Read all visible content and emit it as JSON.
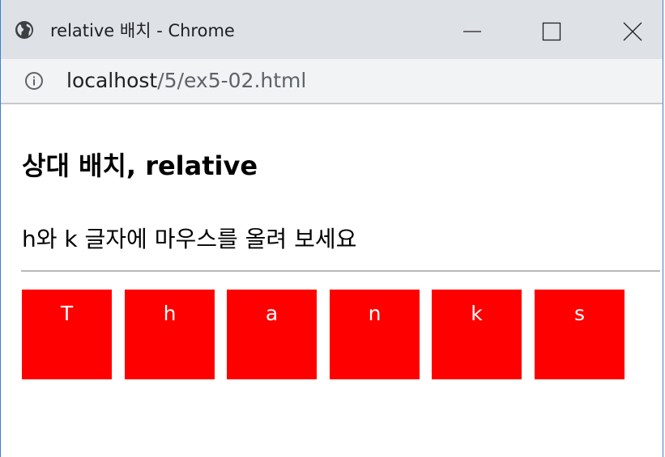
{
  "window": {
    "title": "relative 배치 - Chrome",
    "minimize_label": "Minimize",
    "maximize_label": "Maximize",
    "close_label": "Close"
  },
  "address": {
    "host": "localhost",
    "path": "/5/ex5-02.html"
  },
  "page": {
    "heading": "상대 배치, relative",
    "instruction": "h와 k 글자에 마우스를 올려 보세요",
    "letters": [
      "T",
      "h",
      "a",
      "n",
      "k",
      "s"
    ]
  },
  "colors": {
    "box_background": "#ff0000",
    "box_text": "#ffffff",
    "titlebar": "#dee1e6",
    "addressbar": "#f1f3f4"
  },
  "icons": {
    "tab": "globe-icon",
    "site_info": "info-icon"
  }
}
